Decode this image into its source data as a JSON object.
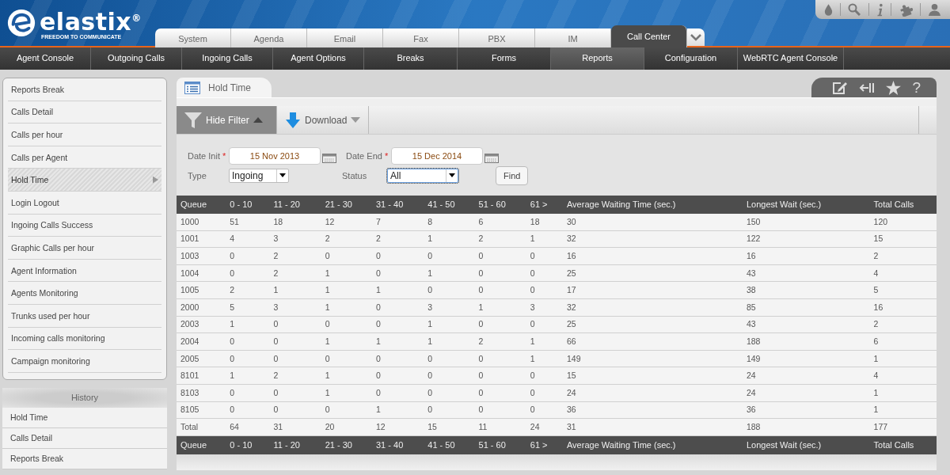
{
  "logo": {
    "name": "elastix",
    "registered": "®",
    "tagline": "FREEDOM TO COMMUNICATE"
  },
  "main_tabs": [
    {
      "label": "System",
      "selected": false
    },
    {
      "label": "Agenda",
      "selected": false
    },
    {
      "label": "Email",
      "selected": false
    },
    {
      "label": "Fax",
      "selected": false
    },
    {
      "label": "PBX",
      "selected": false
    },
    {
      "label": "IM",
      "selected": false
    },
    {
      "label": "Call Center",
      "selected": true
    }
  ],
  "sub_nav": [
    {
      "label": "Agent Console",
      "selected": false
    },
    {
      "label": "Outgoing Calls",
      "selected": false
    },
    {
      "label": "Ingoing Calls",
      "selected": false
    },
    {
      "label": "Agent Options",
      "selected": false
    },
    {
      "label": "Breaks",
      "selected": false
    },
    {
      "label": "Forms",
      "selected": false
    },
    {
      "label": "Reports",
      "selected": true
    },
    {
      "label": "Configuration",
      "selected": false
    },
    {
      "label": "WebRTC Agent Console",
      "selected": false
    }
  ],
  "sidebar": {
    "items": [
      {
        "label": "Reports Break",
        "selected": false
      },
      {
        "label": "Calls Detail",
        "selected": false
      },
      {
        "label": "Calls per hour",
        "selected": false
      },
      {
        "label": "Calls per Agent",
        "selected": false
      },
      {
        "label": "Hold Time",
        "selected": true
      },
      {
        "label": "Login Logout",
        "selected": false
      },
      {
        "label": "Ingoing Calls Success",
        "selected": false
      },
      {
        "label": "Graphic Calls per hour",
        "selected": false
      },
      {
        "label": "Agent Information",
        "selected": false
      },
      {
        "label": "Agents Monitoring",
        "selected": false
      },
      {
        "label": "Trunks used per hour",
        "selected": false
      },
      {
        "label": "Incoming calls monitoring",
        "selected": false
      },
      {
        "label": "Campaign monitoring",
        "selected": false
      }
    ]
  },
  "history": {
    "title": "History",
    "items": [
      "Hold Time",
      "Calls Detail",
      "Reports Break"
    ]
  },
  "module": {
    "title": "Hold Time",
    "help": "?"
  },
  "toolbar": {
    "hide_filter": "Hide Filter",
    "download": "Download"
  },
  "filter": {
    "date_init": {
      "label": "Date Init",
      "required_mark": "*",
      "value": "15 Nov 2013"
    },
    "date_end": {
      "label": "Date End",
      "required_mark": "*",
      "value": "15 Dec 2014"
    },
    "type": {
      "label": "Type",
      "value": "Ingoing",
      "focused": false
    },
    "status": {
      "label": "Status",
      "value": "All",
      "focused": true
    },
    "find": "Find"
  },
  "table": {
    "columns": [
      "Queue",
      "0 - 10",
      "11 - 20",
      "21 - 30",
      "31 - 40",
      "41 - 50",
      "51 - 60",
      "61 >",
      "Average Waiting Time (sec.)",
      "Longest Wait (sec.)",
      "Total Calls"
    ],
    "rows": [
      [
        "1000",
        "51",
        "18",
        "12",
        "7",
        "8",
        "6",
        "18",
        "30",
        "150",
        "120"
      ],
      [
        "1001",
        "4",
        "3",
        "2",
        "2",
        "1",
        "2",
        "1",
        "32",
        "122",
        "15"
      ],
      [
        "1003",
        "0",
        "2",
        "0",
        "0",
        "0",
        "0",
        "0",
        "16",
        "16",
        "2"
      ],
      [
        "1004",
        "0",
        "2",
        "1",
        "0",
        "1",
        "0",
        "0",
        "25",
        "43",
        "4"
      ],
      [
        "1005",
        "2",
        "1",
        "1",
        "1",
        "0",
        "0",
        "0",
        "17",
        "38",
        "5"
      ],
      [
        "2000",
        "5",
        "3",
        "1",
        "0",
        "3",
        "1",
        "3",
        "32",
        "85",
        "16"
      ],
      [
        "2003",
        "1",
        "0",
        "0",
        "0",
        "1",
        "0",
        "0",
        "25",
        "43",
        "2"
      ],
      [
        "2004",
        "0",
        "0",
        "1",
        "1",
        "1",
        "2",
        "1",
        "66",
        "188",
        "6"
      ],
      [
        "2005",
        "0",
        "0",
        "0",
        "0",
        "0",
        "0",
        "1",
        "149",
        "149",
        "1"
      ],
      [
        "8101",
        "1",
        "2",
        "1",
        "0",
        "0",
        "0",
        "0",
        "15",
        "24",
        "4"
      ],
      [
        "8103",
        "0",
        "0",
        "1",
        "0",
        "0",
        "0",
        "0",
        "24",
        "24",
        "1"
      ],
      [
        "8105",
        "0",
        "0",
        "0",
        "1",
        "0",
        "0",
        "0",
        "36",
        "36",
        "1"
      ],
      [
        "Total",
        "64",
        "31",
        "20",
        "12",
        "15",
        "11",
        "24",
        "31",
        "188",
        "177"
      ]
    ],
    "footer_columns": [
      "Queue",
      "0 - 10",
      "11 - 20",
      "21 - 30",
      "31 - 40",
      "41 - 50",
      "51 - 60",
      "61 >",
      "Average Waiting Time (sec.)",
      "Longest Wait (sec.)",
      "Total Calls"
    ]
  }
}
